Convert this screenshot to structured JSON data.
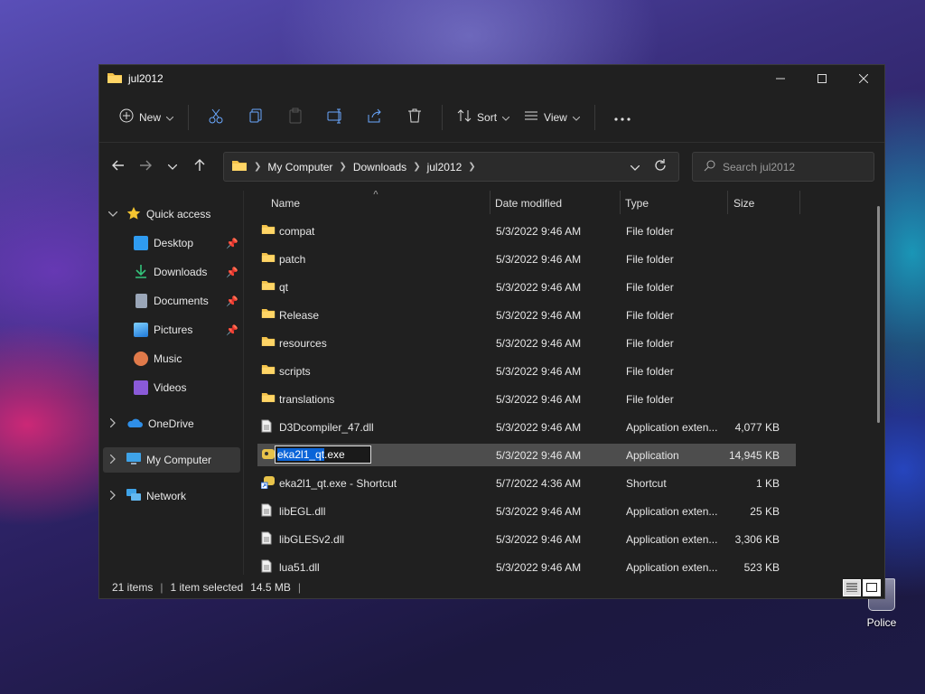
{
  "desktop": {
    "icon_label": "Police"
  },
  "window": {
    "title": "jul2012"
  },
  "toolbar": {
    "new_label": "New",
    "sort_label": "Sort",
    "view_label": "View"
  },
  "address": {
    "crumbs": [
      "My Computer",
      "Downloads",
      "jul2012"
    ]
  },
  "search": {
    "placeholder": "Search jul2012"
  },
  "sidebar": {
    "quick_access": "Quick access",
    "items": [
      {
        "label": "Desktop",
        "color": "#2f9bf0"
      },
      {
        "label": "Downloads",
        "color": "#33c27a"
      },
      {
        "label": "Documents",
        "color": "#9aa6b8"
      },
      {
        "label": "Pictures",
        "color": "#3aa0f0"
      },
      {
        "label": "Music",
        "color": "#e07a4a"
      },
      {
        "label": "Videos",
        "color": "#8a5ad8"
      }
    ],
    "onedrive": "OneDrive",
    "my_computer": "My Computer",
    "network": "Network"
  },
  "columns": {
    "name": "Name",
    "date": "Date modified",
    "type": "Type",
    "size": "Size"
  },
  "files": [
    {
      "name": "compat",
      "date": "5/3/2022 9:46 AM",
      "type": "File folder",
      "size": "",
      "kind": "folder"
    },
    {
      "name": "patch",
      "date": "5/3/2022 9:46 AM",
      "type": "File folder",
      "size": "",
      "kind": "folder"
    },
    {
      "name": "qt",
      "date": "5/3/2022 9:46 AM",
      "type": "File folder",
      "size": "",
      "kind": "folder"
    },
    {
      "name": "Release",
      "date": "5/3/2022 9:46 AM",
      "type": "File folder",
      "size": "",
      "kind": "folder"
    },
    {
      "name": "resources",
      "date": "5/3/2022 9:46 AM",
      "type": "File folder",
      "size": "",
      "kind": "folder"
    },
    {
      "name": "scripts",
      "date": "5/3/2022 9:46 AM",
      "type": "File folder",
      "size": "",
      "kind": "folder"
    },
    {
      "name": "translations",
      "date": "5/3/2022 9:46 AM",
      "type": "File folder",
      "size": "",
      "kind": "folder"
    },
    {
      "name": "D3Dcompiler_47.dll",
      "date": "5/3/2022 9:46 AM",
      "type": "Application exten...",
      "size": "4,077 KB",
      "kind": "dll"
    },
    {
      "name": "eka2l1_qt.exe",
      "date": "5/3/2022 9:46 AM",
      "type": "Application",
      "size": "14,945 KB",
      "kind": "exe"
    },
    {
      "name": "eka2l1_qt.exe - Shortcut",
      "date": "5/7/2022 4:36 AM",
      "type": "Shortcut",
      "size": "1 KB",
      "kind": "shortcut"
    },
    {
      "name": "libEGL.dll",
      "date": "5/3/2022 9:46 AM",
      "type": "Application exten...",
      "size": "25 KB",
      "kind": "dll"
    },
    {
      "name": "libGLESv2.dll",
      "date": "5/3/2022 9:46 AM",
      "type": "Application exten...",
      "size": "3,306 KB",
      "kind": "dll"
    },
    {
      "name": "lua51.dll",
      "date": "5/3/2022 9:46 AM",
      "type": "Application exten...",
      "size": "523 KB",
      "kind": "dll"
    }
  ],
  "rename": {
    "selected_part": "eka2l1_qt",
    "rest": ".exe"
  },
  "status": {
    "count": "21 items",
    "selected": "1 item selected",
    "size": "14.5 MB"
  }
}
